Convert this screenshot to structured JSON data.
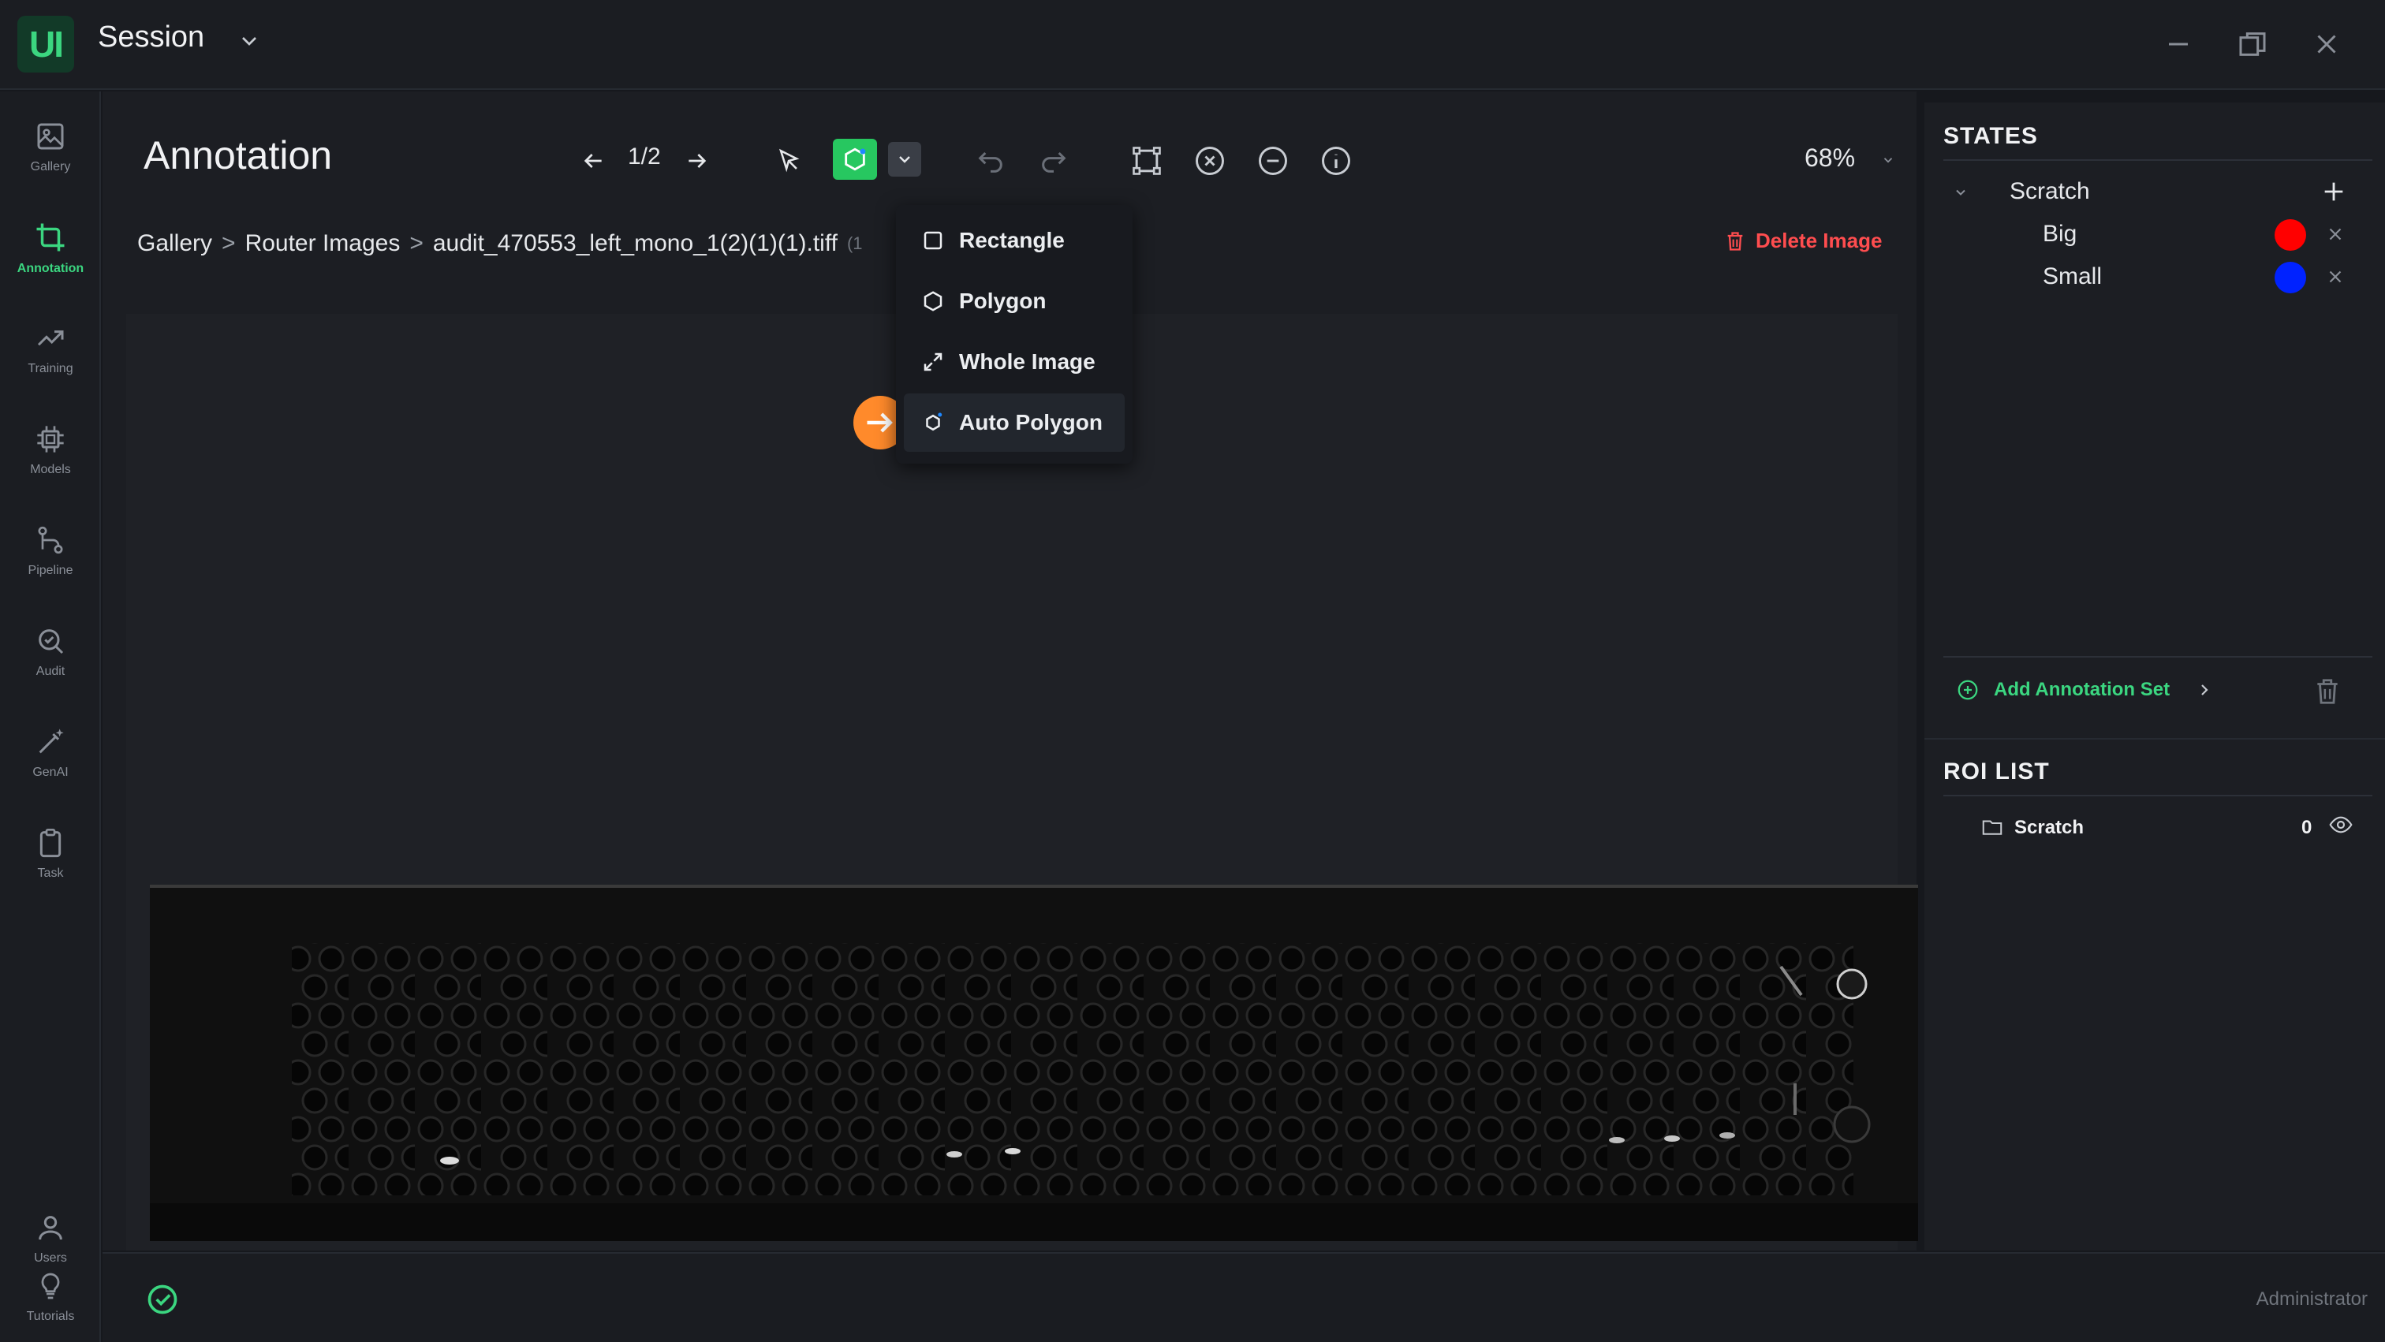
{
  "app": {
    "logo_text": "UI",
    "session_title": "Session",
    "accent": "#3bd680",
    "danger": "#ff4d4f"
  },
  "window_controls": [
    "minimize-icon",
    "restore-icon",
    "close-icon"
  ],
  "nav": {
    "items": [
      {
        "label": "Gallery",
        "icon": "gallery-icon"
      },
      {
        "label": "Annotation",
        "icon": "crop-icon",
        "active": true
      },
      {
        "label": "Training",
        "icon": "trend-icon"
      },
      {
        "label": "Models",
        "icon": "chip-icon"
      },
      {
        "label": "Pipeline",
        "icon": "pipeline-icon"
      },
      {
        "label": "Audit",
        "icon": "audit-icon"
      },
      {
        "label": "GenAI",
        "icon": "genai-icon"
      },
      {
        "label": "Task",
        "icon": "clipboard-icon"
      }
    ],
    "bottom_items": [
      {
        "label": "Users",
        "icon": "user-icon"
      },
      {
        "label": "Tutorials",
        "icon": "bulb-icon"
      }
    ]
  },
  "toolbar": {
    "title": "Annotation",
    "page_counter": "1/2",
    "zoom": "68%"
  },
  "breadcrumb": {
    "gallery": "Gallery",
    "sep": ">",
    "folder": "Router Images",
    "file": "audit_470553_left_mono_1(2)(1)(1).tiff",
    "suffix": "(1"
  },
  "delete_image_label": "Delete Image",
  "shape_menu": {
    "items": [
      {
        "label": "Rectangle",
        "icon": "square-icon"
      },
      {
        "label": "Polygon",
        "icon": "hexagon-icon"
      },
      {
        "label": "Whole Image",
        "icon": "expand-icon"
      },
      {
        "label": "Auto Polygon",
        "icon": "auto-polygon-icon",
        "highlighted": true
      }
    ]
  },
  "states": {
    "title": "STATES",
    "group": "Scratch",
    "items": [
      {
        "name": "Big",
        "color": "#ff0000"
      },
      {
        "name": "Small",
        "color": "#0022ff"
      }
    ],
    "add_set_label": "Add Annotation Set"
  },
  "roi_list": {
    "title": "ROI LIST",
    "items": [
      {
        "name": "Scratch",
        "count": "0"
      }
    ]
  },
  "footer": {
    "user": "Administrator"
  }
}
